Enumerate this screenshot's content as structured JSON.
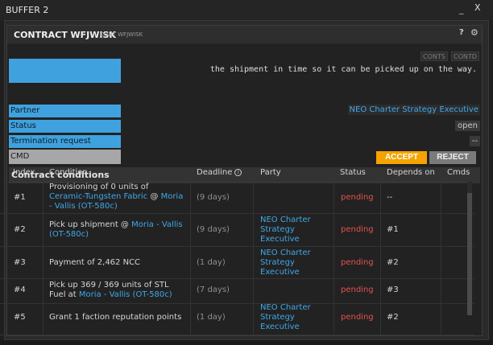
{
  "window": {
    "title": "BUFFER 2",
    "minimize_label": "_",
    "close_label": "X"
  },
  "tile": {
    "command": "CONTRACT WFJWISK",
    "subtitle": "CONT WFJWISK",
    "help_label": "?",
    "settings_label": "⚙"
  },
  "tabs": [
    "CONTS",
    "CONTD"
  ],
  "description_text": "the shipment in time so it can be picked up on the way.",
  "form": {
    "partner_label": "Partner",
    "partner_value": "NEO Charter Strategy Executive",
    "status_label": "Status",
    "status_value": "open",
    "termination_label": "Termination request",
    "termination_value": "--",
    "cmd_label": "CMD",
    "accept_label": "ACCEPT",
    "reject_label": "REJECT"
  },
  "conditions": {
    "section_title": "Contract conditions",
    "columns": {
      "index": "Index",
      "condition": "Condition",
      "deadline": "Deadline",
      "party": "Party",
      "status": "Status",
      "depends_on": "Depends on",
      "cmds": "Cmds"
    },
    "rows": [
      {
        "index": "#1",
        "condition_line1": "Provisioning of 0 units of",
        "condition_link": "Ceramic-Tungsten Fabric",
        "condition_at": "@",
        "condition_location": "Moria",
        "condition_location2": "- Vallis (OT-580c)",
        "deadline": "(9 days)",
        "party": "",
        "status": "pending",
        "depends_on": "--"
      },
      {
        "index": "#2",
        "condition_line1": "Pick up shipment @",
        "condition_location": "Moria - Vallis",
        "condition_location2": "(OT-580c)",
        "deadline": "(9 days)",
        "party": "NEO Charter Strategy Executive",
        "status": "pending",
        "depends_on": "#1"
      },
      {
        "index": "#3",
        "condition_line1": "Payment of 2,462 NCC",
        "deadline": "(1 day)",
        "party": "NEO Charter Strategy Executive",
        "status": "pending",
        "depends_on": "#2"
      },
      {
        "index": "#4",
        "condition_line1": "Pick up 369 / 369 units of STL",
        "condition_line2": "Fuel at",
        "condition_location": "Moria - Vallis (OT-580c)",
        "deadline": "(7 days)",
        "party": "",
        "status": "pending",
        "depends_on": "#3"
      },
      {
        "index": "#5",
        "condition_line1": "Grant 1 faction reputation points",
        "deadline": "(1 day)",
        "party": "NEO Charter Strategy Executive",
        "status": "pending",
        "depends_on": "#2"
      }
    ]
  },
  "colors": {
    "accent_blue": "#3fa2de",
    "accept_orange": "#f4a300",
    "pending_red": "#e2524f"
  }
}
